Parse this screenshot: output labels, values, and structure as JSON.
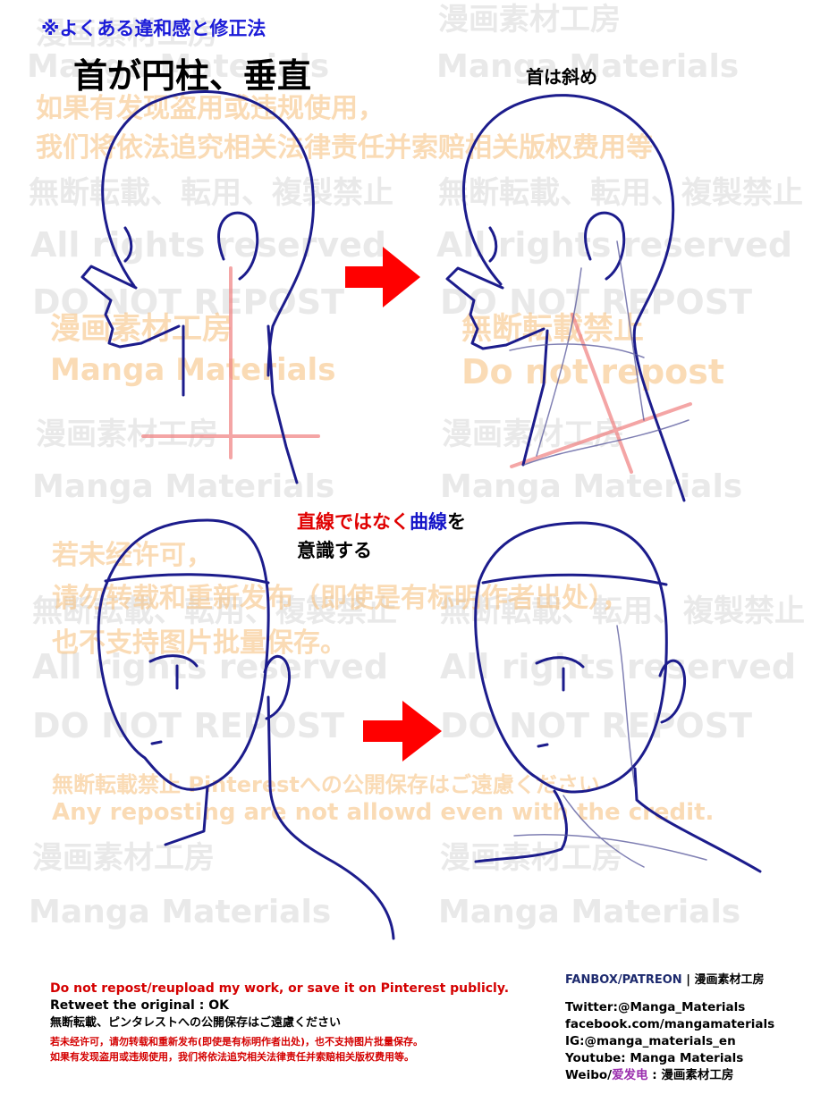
{
  "header": {
    "subtitle": "※よくある違和感と修正法",
    "title": "首が円柱、垂直",
    "right_label": "首は斜め"
  },
  "note": {
    "part_red": "直線ではなく",
    "part_blue": "曲線",
    "part_end": "を",
    "line2": "意識する"
  },
  "watermarks": {
    "cn_warning_1": "如果有发现盗用或违规使用，",
    "cn_warning_2": "我们将依法追究相关法律责任并索赔相关版权费用等",
    "jp_no_repost": "無断転載、転用、複製禁止",
    "all_rights": "All rights reserved",
    "do_not_repost_caps": "DO NOT REPOST",
    "studio_jp": "漫画素材工房",
    "brand": "Manga Materials",
    "jp_forbidden": "無断転載禁止",
    "do_not_repost": "Do not repost",
    "cn_permission_1": "若未经许可，",
    "cn_permission_2": "请勿转载和重新发布（即使是有标明作者出处），",
    "cn_permission_3": "也不支持图片批量保存。",
    "pinterest_jp": "無断転載禁止 Pinterestへの公開保存はご遠慮ください",
    "credit_en": "Any reposting are not allowd even with the credit."
  },
  "footer": {
    "warning_en": "Do not repost/reupload my work, or save it on Pinterest publicly.",
    "retweet": "Retweet the original : OK",
    "jp_notice": "無断転載、ピンタレストへの公開保存はご遠慮ください",
    "cn_notice_1": "若未经许可，请勿转载和重新发布(即使是有标明作者出处)，也不支持图片批量保存。",
    "cn_notice_2": "如果有发现盗用或违规使用，我们将依法追究相关法律责任并索赔相关版权费用等。",
    "fanbox_patreon": "FANBOX/PATREON",
    "fanbox_sep": " | ",
    "fanbox_name": "漫画素材工房",
    "twitter": "Twitter:@Manga_Materials",
    "facebook": "facebook.com/mangamaterials",
    "instagram": "IG:@manga_materials_en",
    "youtube": "Youtube: Manga Materials",
    "weibo_prefix": "Weibo/",
    "weibo_name": "爱发电",
    "weibo_suffix": " : 漫画素材工房"
  },
  "colors": {
    "line_blue": "#1c1c8c",
    "arrow_red": "#ff0000",
    "guide_red": "#f08080",
    "title_blue": "#1b1bd8",
    "warning_red": "#d40000",
    "link_blue": "#1d2a6e",
    "weibo_purple": "#9b2fae"
  }
}
